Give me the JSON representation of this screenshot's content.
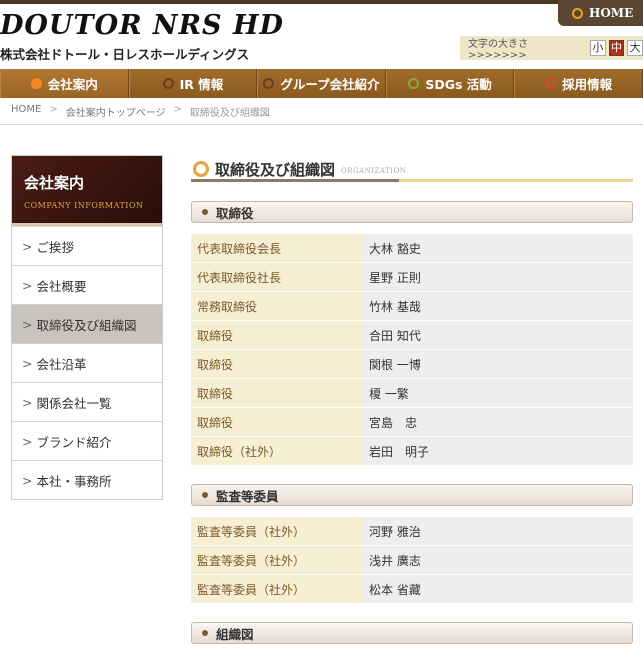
{
  "header": {
    "logo_main": "DOUTOR NRS HD",
    "logo_sub": "株式会社ドトール・日レスホールディングス",
    "home_label": "HOME",
    "font_size_label": "文字の大きさ >>>>>>>",
    "font_sizes": [
      "小",
      "中",
      "大"
    ],
    "font_size_selected": "中"
  },
  "nav": {
    "items": [
      {
        "label": "会社案内"
      },
      {
        "label": "IR 情報"
      },
      {
        "label": "グループ会社紹介"
      },
      {
        "label": "SDGs 活動"
      },
      {
        "label": "採用情報"
      }
    ]
  },
  "breadcrumb": {
    "items": [
      "HOME",
      "会社案内トップページ",
      "取締役及び組織図"
    ],
    "separator": ">"
  },
  "sidebar": {
    "title": "会社案内",
    "subtitle": "COMPANY INFORMATION",
    "chevron": ">",
    "items": [
      {
        "label": "ご挨拶"
      },
      {
        "label": "会社概要"
      },
      {
        "label": "取締役及び組織図",
        "active": true
      },
      {
        "label": "会社沿革"
      },
      {
        "label": "関係会社一覧"
      },
      {
        "label": "ブランド紹介"
      },
      {
        "label": "本社・事務所"
      }
    ]
  },
  "main": {
    "title": "取締役及び組織図",
    "title_sub": "ORGANIZATION",
    "sections": [
      {
        "heading": "取締役",
        "rows": [
          {
            "role": "代表取締役会長",
            "name": "大林 豁史"
          },
          {
            "role": "代表取締役社長",
            "name": "星野 正則"
          },
          {
            "role": "常務取締役",
            "name": "竹林 基哉"
          },
          {
            "role": "取締役",
            "name": "合田 知代"
          },
          {
            "role": "取締役",
            "name": "関根 一博"
          },
          {
            "role": "取締役",
            "name": "榎 一繁"
          },
          {
            "role": "取締役",
            "name": "宮島　忠"
          },
          {
            "role": "取締役（社外）",
            "name": "岩田　明子"
          }
        ]
      },
      {
        "heading": "監査等委員",
        "rows": [
          {
            "role": "監査等委員（社外）",
            "name": "河野 雅治"
          },
          {
            "role": "監査等委員（社外）",
            "name": "浅井 廣志"
          },
          {
            "role": "監査等委員（社外）",
            "name": "松本 省藏"
          }
        ]
      },
      {
        "heading": "組織図",
        "rows": []
      }
    ]
  },
  "colors": {
    "nav_bg": "#8a5a1e",
    "accent_orange": "#e9a23a",
    "role_bg": "#f6efd4",
    "name_bg": "#eeeeee",
    "sidebar_head_bg": "#4a1d14"
  }
}
